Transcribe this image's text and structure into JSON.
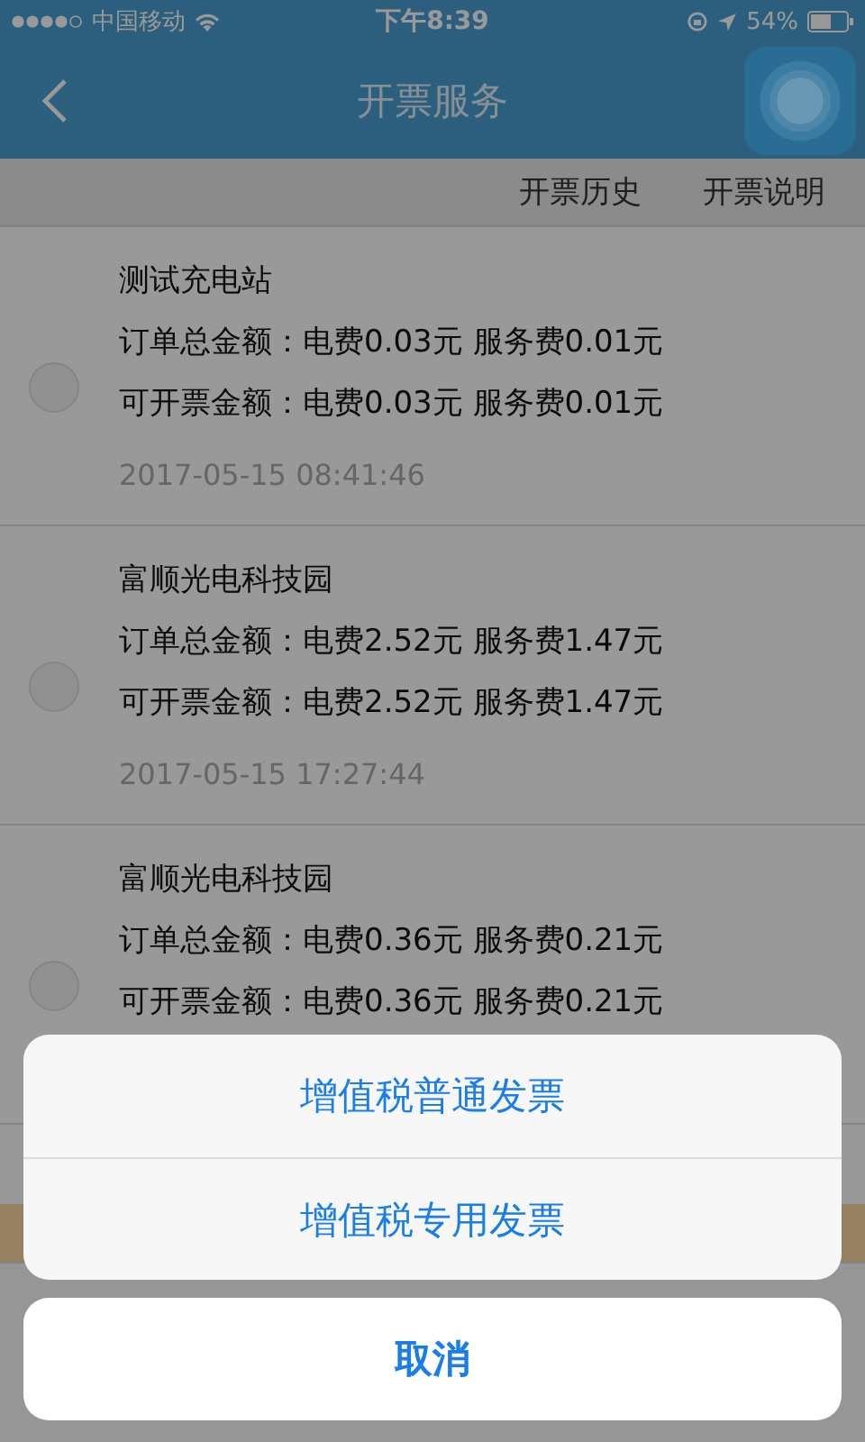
{
  "status_bar": {
    "carrier": "中国移动",
    "time": "下午8:39",
    "battery": "54%"
  },
  "nav": {
    "title": "开票服务"
  },
  "toolbar": {
    "links": [
      "开票历史",
      "开票说明"
    ]
  },
  "orders": [
    {
      "station": "测试充电站",
      "total": "订单总金额：电费0.03元 服务费0.01元",
      "invoiceable": "可开票金额：电费0.03元 服务费0.01元",
      "time": "2017-05-15 08:41:46",
      "selected": false
    },
    {
      "station": "富顺光电科技园",
      "total": "订单总金额：电费2.52元 服务费1.47元",
      "invoiceable": "可开票金额：电费2.52元 服务费1.47元",
      "time": "2017-05-15 17:27:44",
      "selected": false
    },
    {
      "station": "富顺光电科技园",
      "total": "订单总金额：电费0.36元 服务费0.21元",
      "invoiceable": "可开票金额：电费0.36元 服务费0.21元",
      "selected": false
    }
  ],
  "action_sheet": {
    "options": [
      "增值税普通发票",
      "增值税专用发票"
    ],
    "cancel": "取消"
  }
}
